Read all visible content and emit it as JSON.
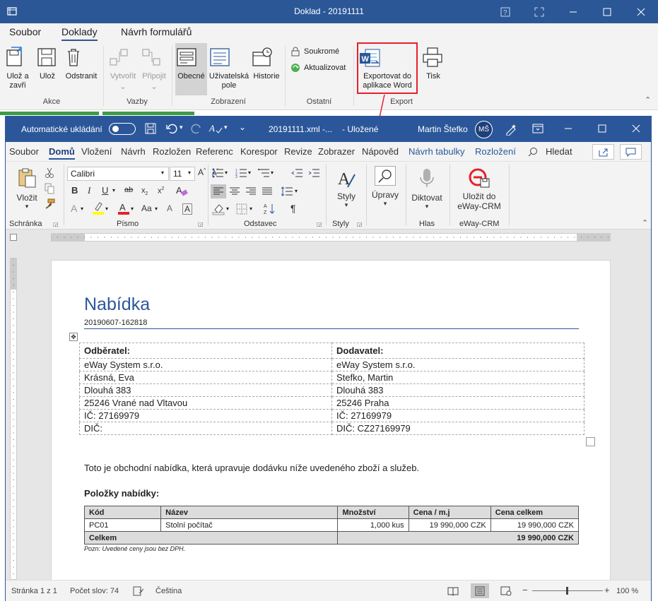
{
  "outer": {
    "title": "Doklad - 20191111",
    "tabs": [
      "Soubor",
      "Doklady",
      "Návrh formulářů"
    ],
    "buttons": {
      "save_close": "Ulož a zavři",
      "save": "Ulož",
      "delete": "Odstranit",
      "create": "Vytvořit",
      "attach": "Připojit",
      "general": "Obecné",
      "user_fields": "Uživatelská pole",
      "history": "Historie",
      "private": "Soukromé",
      "refresh": "Aktualizovat",
      "export_word": "Exportovat do aplikace Word",
      "print": "Tisk"
    },
    "groups": [
      "Akce",
      "Vazby",
      "Zobrazení",
      "Ostatní",
      "Export"
    ]
  },
  "word": {
    "autosave": "Automatické ukládání",
    "filename": "20191111.xml  -...",
    "saved": "Uložené",
    "user": "Martin Štefko",
    "initials": "MŠ",
    "menu": [
      "Soubor",
      "Domů",
      "Vložení",
      "Návrh",
      "Rozložen",
      "Referenc",
      "Korespor",
      "Revize",
      "Zobrazer",
      "Nápověd",
      "Návrh tabulky",
      "Rozložení"
    ],
    "search": "Hledat",
    "font_name": "Calibri",
    "font_size": "11",
    "ribbon": {
      "paste": "Vložit",
      "styles": "Styly",
      "editing": "Úpravy",
      "dictate": "Diktovat",
      "save_crm": "Uložit do eWay-CRM"
    },
    "groups": [
      "Schránka",
      "Písmo",
      "Odstavec",
      "Styly",
      "Hlas",
      "eWay-CRM"
    ],
    "status": {
      "page": "Stránka 1 z 1",
      "words": "Počet slov: 74",
      "lang": "Čeština",
      "zoom": "100 %"
    }
  },
  "doc": {
    "title": "Nabídka",
    "number": "20190607-162818",
    "party_table": {
      "headers": [
        "Odběratel:",
        "Dodavatel:"
      ],
      "rows": [
        [
          "eWay System s.r.o.",
          "eWay System s.r.o."
        ],
        [
          "Krásná, Eva",
          "Stefko, Martin"
        ],
        [
          "Dlouhá 383",
          "Dlouhá 383"
        ],
        [
          "25246 Vrané nad Vltavou",
          "25246 Praha"
        ],
        [
          "IČ: 27169979",
          "IČ: 27169979"
        ],
        [
          "DIČ:",
          "DIČ: CZ27169979"
        ]
      ]
    },
    "intro": "Toto je obchodní nabídka, která upravuje dodávku níže uvedeného zboží a služeb.",
    "items_heading": "Položky nabídky:",
    "items_table": {
      "headers": [
        "Kód",
        "Název",
        "Množství",
        "Cena / m.j",
        "Cena celkem"
      ],
      "rows": [
        [
          "PC01",
          "Stolní počítač",
          "1,000 kus",
          "19 990,000 CZK",
          "19 990,000 CZK"
        ]
      ],
      "total_label": "Celkem",
      "total_value": "19 990,000 CZK"
    },
    "note": "Pozn: Uvedené ceny jsou bez DPH."
  },
  "colors": {
    "outer_title": "#2b5797",
    "word_blue": "#2b579a",
    "highlight": "#e8202a"
  }
}
